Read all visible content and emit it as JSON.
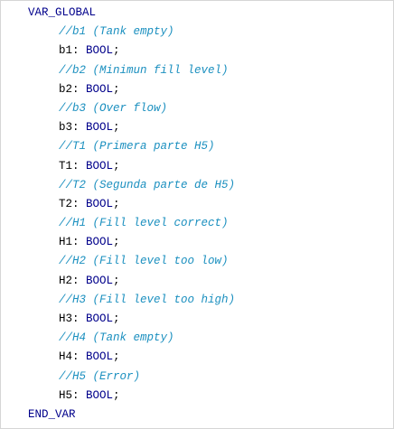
{
  "editor": {
    "lines": [
      {
        "kind": "keyword",
        "text": "VAR_GLOBAL"
      },
      {
        "kind": "comment",
        "text": "//b1 (Tank empty)"
      },
      {
        "kind": "decl",
        "name": "b1: ",
        "type": "BOOL",
        "end": ";"
      },
      {
        "kind": "comment",
        "text": "//b2 (Minimun fill level)"
      },
      {
        "kind": "decl",
        "name": "b2: ",
        "type": "BOOL",
        "end": ";"
      },
      {
        "kind": "comment",
        "text": "//b3 (Over flow)"
      },
      {
        "kind": "decl",
        "name": "b3: ",
        "type": "BOOL",
        "end": ";"
      },
      {
        "kind": "comment",
        "text": "//T1 (Primera parte H5)"
      },
      {
        "kind": "decl",
        "name": "T1: ",
        "type": "BOOL",
        "end": ";"
      },
      {
        "kind": "comment",
        "text": "//T2 (Segunda parte de H5)"
      },
      {
        "kind": "decl",
        "name": "T2: ",
        "type": "BOOL",
        "end": ";"
      },
      {
        "kind": "comment",
        "text": "//H1 (Fill level correct)"
      },
      {
        "kind": "decl",
        "name": "H1: ",
        "type": "BOOL",
        "end": ";"
      },
      {
        "kind": "comment",
        "text": "//H2 (Fill level too low)"
      },
      {
        "kind": "decl",
        "name": "H2: ",
        "type": "BOOL",
        "end": ";"
      },
      {
        "kind": "comment",
        "text": "//H3 (Fill level too high)"
      },
      {
        "kind": "decl",
        "name": "H3: ",
        "type": "BOOL",
        "end": ";"
      },
      {
        "kind": "comment",
        "text": "//H4 (Tank empty)"
      },
      {
        "kind": "decl",
        "name": "H4: ",
        "type": "BOOL",
        "end": ";"
      },
      {
        "kind": "comment",
        "text": "//H5 (Error)"
      },
      {
        "kind": "decl",
        "name": "H5: ",
        "type": "BOOL",
        "end": ";"
      },
      {
        "kind": "keyword",
        "text": "END_VAR"
      }
    ],
    "colors": {
      "keyword": "#00008b",
      "comment": "#1a8fbf",
      "identifier": "#000000",
      "background": "#ffffff",
      "border": "#d6d6d6"
    }
  }
}
